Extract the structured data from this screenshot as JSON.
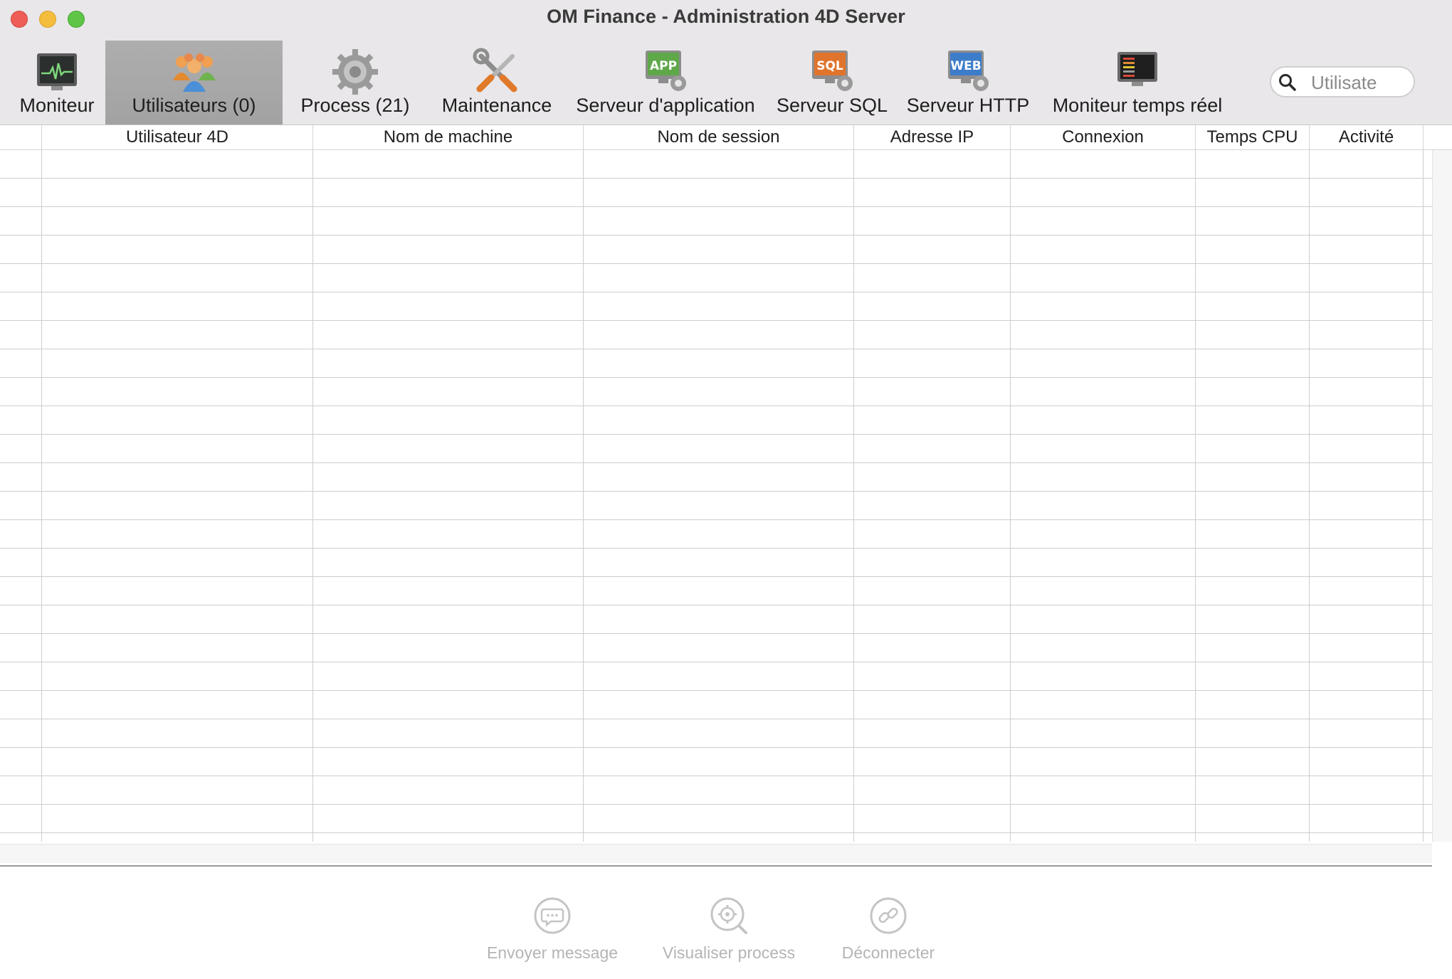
{
  "window": {
    "title": "OM Finance - Administration 4D Server"
  },
  "toolbar": {
    "items": [
      {
        "label": "Moniteur",
        "icon": "monitor-icon",
        "selected": false
      },
      {
        "label": "Utilisateurs (0)",
        "icon": "users-icon",
        "selected": true
      },
      {
        "label": "Process (21)",
        "icon": "gear-icon",
        "selected": false
      },
      {
        "label": "Maintenance",
        "icon": "tools-icon",
        "selected": false
      },
      {
        "label": "Serveur d'application",
        "icon": "app-server-icon",
        "selected": false
      },
      {
        "label": "Serveur SQL",
        "icon": "sql-server-icon",
        "selected": false
      },
      {
        "label": "Serveur HTTP",
        "icon": "web-server-icon",
        "selected": false
      },
      {
        "label": "Moniteur temps réel",
        "icon": "realtime-monitor-icon",
        "selected": false
      }
    ],
    "search": {
      "placeholder": "Utilisate",
      "value": ""
    }
  },
  "table": {
    "columns": [
      "Utilisateur 4D",
      "Nom de machine",
      "Nom de session",
      "Adresse IP",
      "Connexion",
      "Temps CPU",
      "Activité"
    ],
    "rows": []
  },
  "actions": {
    "items": [
      {
        "label": "Envoyer message",
        "icon": "message-icon",
        "enabled": false
      },
      {
        "label": "Visualiser process",
        "icon": "view-process-icon",
        "enabled": false
      },
      {
        "label": "Déconnecter",
        "icon": "disconnect-icon",
        "enabled": false
      }
    ]
  },
  "colors": {
    "titlebar_bg": "#e9e7e9",
    "selected_tab_bg": "#a6a6a6",
    "grid_line": "#cdcdcd",
    "disabled_text": "#b4b4b4",
    "close": "#ee5d57",
    "minimize": "#f4bd3d",
    "zoom": "#5fc547"
  }
}
